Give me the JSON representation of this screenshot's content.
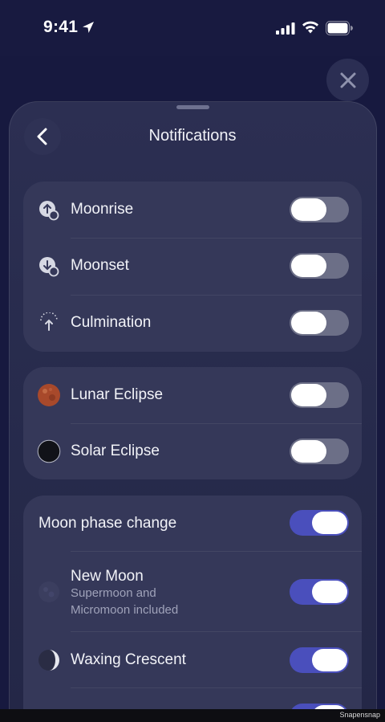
{
  "status_bar": {
    "time": "9:41"
  },
  "header": {
    "title": "Notifications"
  },
  "groups": {
    "events": [
      {
        "label": "Moonrise",
        "on": false
      },
      {
        "label": "Moonset",
        "on": false
      },
      {
        "label": "Culmination",
        "on": false
      }
    ],
    "eclipses": [
      {
        "label": "Lunar Eclipse",
        "on": false
      },
      {
        "label": "Solar Eclipse",
        "on": false
      }
    ],
    "phases": {
      "master": {
        "label": "Moon phase change",
        "on": true
      },
      "new_moon": {
        "label": "New Moon",
        "sub1": "Supermoon and",
        "sub2": "Micromoon included",
        "on": true
      },
      "waxing_crescent": {
        "label": "Waxing Crescent",
        "on": true
      },
      "next": {
        "label": "",
        "on": true
      }
    }
  },
  "watermark": "Snapensnap",
  "colors": {
    "accent": "#4a4fbc",
    "toggle_off": "#6c6f87",
    "background": "#17193f",
    "card": "#353859"
  },
  "icons": [
    "location-arrow-icon",
    "signal-icon",
    "wifi-icon",
    "battery-icon",
    "close-icon",
    "chevron-left-icon",
    "moonrise-icon",
    "moonset-icon",
    "culmination-icon",
    "lunar-eclipse-icon",
    "solar-eclipse-icon",
    "new-moon-icon",
    "waxing-crescent-icon"
  ]
}
